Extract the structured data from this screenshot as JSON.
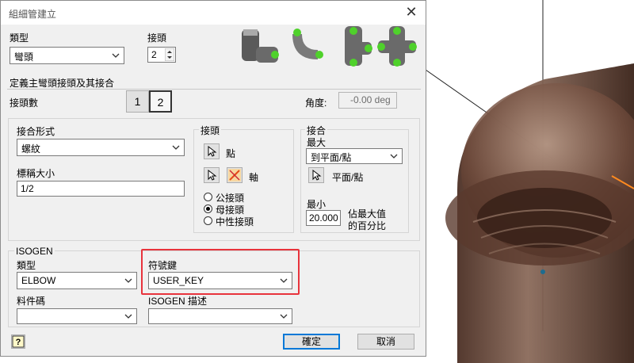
{
  "dialog": {
    "title": "組細管建立",
    "ok_label": "確定",
    "cancel_label": "取消"
  },
  "top": {
    "type_label": "類型",
    "type_value": "彎頭",
    "joint_label": "接頭",
    "joint_value": "2"
  },
  "define": {
    "heading": "定義主彎頭接頭及其接合",
    "joint_count_label": "接頭數",
    "joint_count_options": [
      "1",
      "2"
    ],
    "angle_label": "角度:",
    "angle_value": "-0.00 deg"
  },
  "connection": {
    "form_label": "接合形式",
    "form_value": "螺紋",
    "nominal_label": "標稱大小",
    "nominal_value": "1/2"
  },
  "joint_group": {
    "title": "接頭",
    "point_label": "點",
    "axis_label": "軸",
    "gender_options": [
      "公接頭",
      "母接頭",
      "中性接頭"
    ],
    "selected_gender": 1
  },
  "engage_group": {
    "title": "接合",
    "max_label": "最大",
    "max_value": "到平面/點",
    "plane_point_label": "平面/點",
    "min_label": "最小",
    "min_value": "20.000",
    "estimate_line1": "佔最大值",
    "estimate_line2": "的百分比"
  },
  "isogen": {
    "title": "ISOGEN",
    "type_label": "類型",
    "type_value": "ELBOW",
    "symbol_key_label": "符號鍵",
    "symbol_key_value": "USER_KEY",
    "part_code_label": "料件碼",
    "part_code_value": "",
    "desc_label": "ISOGEN 描述",
    "desc_value": ""
  },
  "colors": {
    "highlight": "#e8333c",
    "model_body": "#7a5444",
    "accent_green": "#4fd12b"
  },
  "icons": [
    "close-icon",
    "help-icon",
    "select-cursor-icon",
    "flip-axis-icon",
    "chevron-down-icon",
    "spin-arrows-icon"
  ]
}
